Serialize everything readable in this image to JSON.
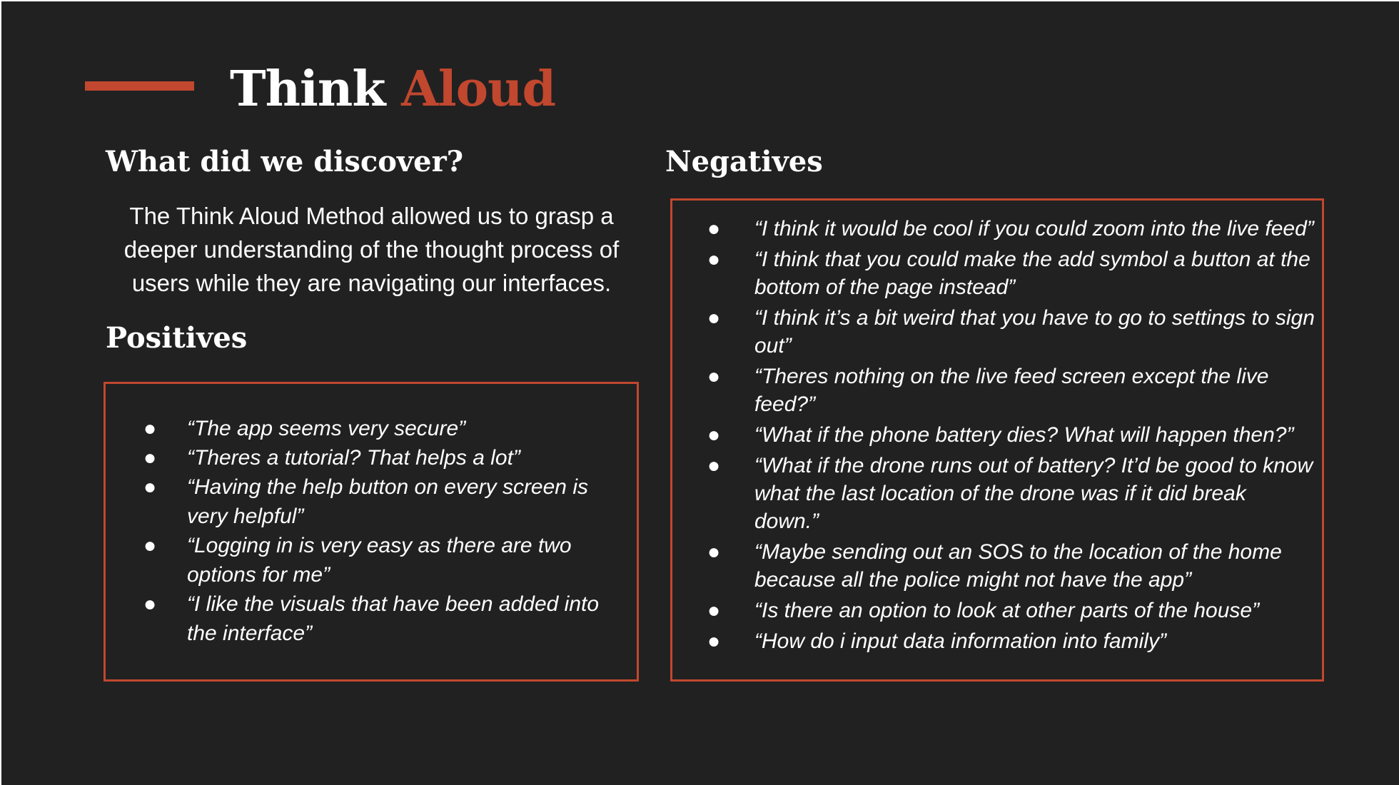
{
  "slide": {
    "title_part1": "Think",
    "title_part2": "Aloud",
    "discover_heading": "What did we discover?",
    "discover_text": "The Think Aloud Method allowed us to grasp a deeper understanding of the thought process of users while they are navigating our interfaces.",
    "positives_heading": "Positives",
    "negatives_heading": "Negatives",
    "bullet_symbol": "●",
    "positives": [
      "“The app seems very secure”",
      "“Theres a tutorial? That helps a lot”",
      "“Having the help button on every screen is very helpful”",
      "“Logging in is very easy as there are two options for me”",
      "“I like the visuals that have been added into the interface”"
    ],
    "negatives": [
      "“I think it would be cool if you could zoom into the live feed”",
      "“I think that you could make the add symbol a button at the bottom of the page instead”",
      "“I think it’s a bit weird that you have to go to settings to sign out”",
      "“Theres nothing on the live feed screen except the live feed?”",
      "“What if the phone battery dies? What will happen then?”",
      "“What if the drone runs out of battery? It’d be good to know what the last location of the drone was if it did break down.”",
      "“Maybe sending out an SOS to the location of the home because all the police might not have the app”",
      "“Is there an option to look at other parts of the house”",
      "“How do i input data information into family”"
    ]
  },
  "colors": {
    "background": "#212121",
    "accent": "#c1472e",
    "text": "#ffffff"
  }
}
